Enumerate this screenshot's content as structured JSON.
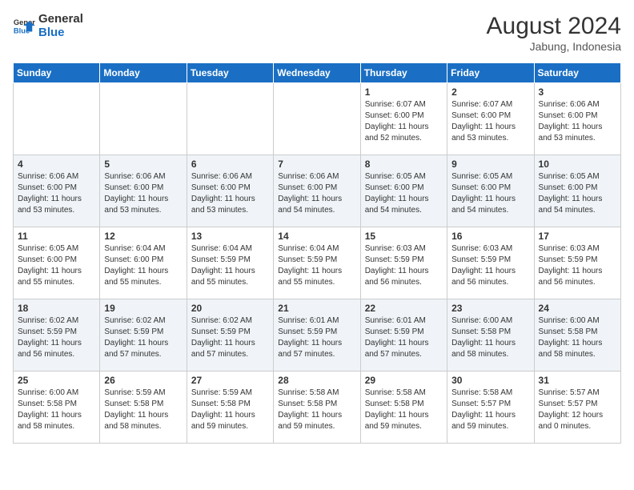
{
  "header": {
    "logo_general": "General",
    "logo_blue": "Blue",
    "month_year": "August 2024",
    "location": "Jabung, Indonesia"
  },
  "weekdays": [
    "Sunday",
    "Monday",
    "Tuesday",
    "Wednesday",
    "Thursday",
    "Friday",
    "Saturday"
  ],
  "weeks": [
    [
      {
        "day": "",
        "sunrise": "",
        "sunset": "",
        "daylight": ""
      },
      {
        "day": "",
        "sunrise": "",
        "sunset": "",
        "daylight": ""
      },
      {
        "day": "",
        "sunrise": "",
        "sunset": "",
        "daylight": ""
      },
      {
        "day": "",
        "sunrise": "",
        "sunset": "",
        "daylight": ""
      },
      {
        "day": "1",
        "sunrise": "Sunrise: 6:07 AM",
        "sunset": "Sunset: 6:00 PM",
        "daylight": "Daylight: 11 hours and 52 minutes."
      },
      {
        "day": "2",
        "sunrise": "Sunrise: 6:07 AM",
        "sunset": "Sunset: 6:00 PM",
        "daylight": "Daylight: 11 hours and 53 minutes."
      },
      {
        "day": "3",
        "sunrise": "Sunrise: 6:06 AM",
        "sunset": "Sunset: 6:00 PM",
        "daylight": "Daylight: 11 hours and 53 minutes."
      }
    ],
    [
      {
        "day": "4",
        "sunrise": "Sunrise: 6:06 AM",
        "sunset": "Sunset: 6:00 PM",
        "daylight": "Daylight: 11 hours and 53 minutes."
      },
      {
        "day": "5",
        "sunrise": "Sunrise: 6:06 AM",
        "sunset": "Sunset: 6:00 PM",
        "daylight": "Daylight: 11 hours and 53 minutes."
      },
      {
        "day": "6",
        "sunrise": "Sunrise: 6:06 AM",
        "sunset": "Sunset: 6:00 PM",
        "daylight": "Daylight: 11 hours and 53 minutes."
      },
      {
        "day": "7",
        "sunrise": "Sunrise: 6:06 AM",
        "sunset": "Sunset: 6:00 PM",
        "daylight": "Daylight: 11 hours and 54 minutes."
      },
      {
        "day": "8",
        "sunrise": "Sunrise: 6:05 AM",
        "sunset": "Sunset: 6:00 PM",
        "daylight": "Daylight: 11 hours and 54 minutes."
      },
      {
        "day": "9",
        "sunrise": "Sunrise: 6:05 AM",
        "sunset": "Sunset: 6:00 PM",
        "daylight": "Daylight: 11 hours and 54 minutes."
      },
      {
        "day": "10",
        "sunrise": "Sunrise: 6:05 AM",
        "sunset": "Sunset: 6:00 PM",
        "daylight": "Daylight: 11 hours and 54 minutes."
      }
    ],
    [
      {
        "day": "11",
        "sunrise": "Sunrise: 6:05 AM",
        "sunset": "Sunset: 6:00 PM",
        "daylight": "Daylight: 11 hours and 55 minutes."
      },
      {
        "day": "12",
        "sunrise": "Sunrise: 6:04 AM",
        "sunset": "Sunset: 6:00 PM",
        "daylight": "Daylight: 11 hours and 55 minutes."
      },
      {
        "day": "13",
        "sunrise": "Sunrise: 6:04 AM",
        "sunset": "Sunset: 5:59 PM",
        "daylight": "Daylight: 11 hours and 55 minutes."
      },
      {
        "day": "14",
        "sunrise": "Sunrise: 6:04 AM",
        "sunset": "Sunset: 5:59 PM",
        "daylight": "Daylight: 11 hours and 55 minutes."
      },
      {
        "day": "15",
        "sunrise": "Sunrise: 6:03 AM",
        "sunset": "Sunset: 5:59 PM",
        "daylight": "Daylight: 11 hours and 56 minutes."
      },
      {
        "day": "16",
        "sunrise": "Sunrise: 6:03 AM",
        "sunset": "Sunset: 5:59 PM",
        "daylight": "Daylight: 11 hours and 56 minutes."
      },
      {
        "day": "17",
        "sunrise": "Sunrise: 6:03 AM",
        "sunset": "Sunset: 5:59 PM",
        "daylight": "Daylight: 11 hours and 56 minutes."
      }
    ],
    [
      {
        "day": "18",
        "sunrise": "Sunrise: 6:02 AM",
        "sunset": "Sunset: 5:59 PM",
        "daylight": "Daylight: 11 hours and 56 minutes."
      },
      {
        "day": "19",
        "sunrise": "Sunrise: 6:02 AM",
        "sunset": "Sunset: 5:59 PM",
        "daylight": "Daylight: 11 hours and 57 minutes."
      },
      {
        "day": "20",
        "sunrise": "Sunrise: 6:02 AM",
        "sunset": "Sunset: 5:59 PM",
        "daylight": "Daylight: 11 hours and 57 minutes."
      },
      {
        "day": "21",
        "sunrise": "Sunrise: 6:01 AM",
        "sunset": "Sunset: 5:59 PM",
        "daylight": "Daylight: 11 hours and 57 minutes."
      },
      {
        "day": "22",
        "sunrise": "Sunrise: 6:01 AM",
        "sunset": "Sunset: 5:59 PM",
        "daylight": "Daylight: 11 hours and 57 minutes."
      },
      {
        "day": "23",
        "sunrise": "Sunrise: 6:00 AM",
        "sunset": "Sunset: 5:58 PM",
        "daylight": "Daylight: 11 hours and 58 minutes."
      },
      {
        "day": "24",
        "sunrise": "Sunrise: 6:00 AM",
        "sunset": "Sunset: 5:58 PM",
        "daylight": "Daylight: 11 hours and 58 minutes."
      }
    ],
    [
      {
        "day": "25",
        "sunrise": "Sunrise: 6:00 AM",
        "sunset": "Sunset: 5:58 PM",
        "daylight": "Daylight: 11 hours and 58 minutes."
      },
      {
        "day": "26",
        "sunrise": "Sunrise: 5:59 AM",
        "sunset": "Sunset: 5:58 PM",
        "daylight": "Daylight: 11 hours and 58 minutes."
      },
      {
        "day": "27",
        "sunrise": "Sunrise: 5:59 AM",
        "sunset": "Sunset: 5:58 PM",
        "daylight": "Daylight: 11 hours and 59 minutes."
      },
      {
        "day": "28",
        "sunrise": "Sunrise: 5:58 AM",
        "sunset": "Sunset: 5:58 PM",
        "daylight": "Daylight: 11 hours and 59 minutes."
      },
      {
        "day": "29",
        "sunrise": "Sunrise: 5:58 AM",
        "sunset": "Sunset: 5:58 PM",
        "daylight": "Daylight: 11 hours and 59 minutes."
      },
      {
        "day": "30",
        "sunrise": "Sunrise: 5:58 AM",
        "sunset": "Sunset: 5:57 PM",
        "daylight": "Daylight: 11 hours and 59 minutes."
      },
      {
        "day": "31",
        "sunrise": "Sunrise: 5:57 AM",
        "sunset": "Sunset: 5:57 PM",
        "daylight": "Daylight: 12 hours and 0 minutes."
      }
    ]
  ]
}
